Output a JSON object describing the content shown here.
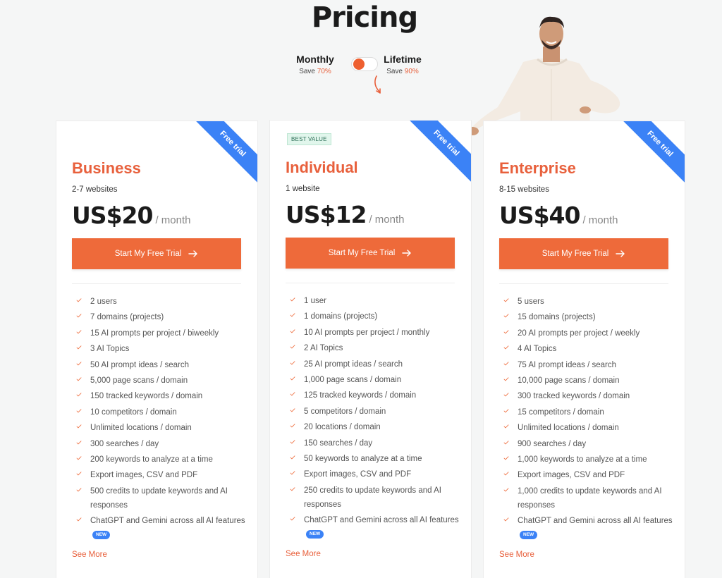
{
  "page": {
    "title": "Pricing"
  },
  "billing": {
    "monthly": {
      "label": "Monthly",
      "save_prefix": "Save ",
      "save_pct": "70%"
    },
    "lifetime": {
      "label": "Lifetime",
      "save_prefix": "Save ",
      "save_pct": "90%"
    },
    "selected": "monthly"
  },
  "colors": {
    "accent": "#ee6a3a",
    "ribbon": "#3b82f6",
    "badge_bg": "#e1f6ec"
  },
  "plans": [
    {
      "ribbon": "Free trial",
      "badge": "",
      "name": "Business",
      "sites": "2-7 websites",
      "price": "US$20",
      "period": "/ month",
      "cta": "Start My Free Trial",
      "features": [
        "2 users",
        "7 domains (projects)",
        "15 AI prompts per project / biweekly",
        "3 AI Topics",
        "50 AI prompt ideas / search",
        "5,000 page scans / domain",
        "150 tracked keywords / domain",
        "10 competitors / domain",
        "Unlimited locations / domain",
        "300 searches / day",
        "200 keywords to analyze at a time",
        "Export images, CSV and PDF",
        "500 credits to update keywords and AI responses",
        "ChatGPT and Gemini across all AI features"
      ],
      "new_badge": "NEW",
      "see_more": "See More"
    },
    {
      "ribbon": "Free trial",
      "badge": "BEST VALUE",
      "name": "Individual",
      "sites": "1 website",
      "price": "US$12",
      "period": "/ month",
      "cta": "Start My Free Trial",
      "features": [
        "1 user",
        "1 domains (projects)",
        "10 AI prompts per project / monthly",
        "2 AI Topics",
        "25 AI prompt ideas / search",
        "1,000 page scans / domain",
        "125 tracked keywords / domain",
        "5 competitors / domain",
        "20 locations / domain",
        "150 searches / day",
        "50 keywords to analyze at a time",
        "Export images, CSV and PDF",
        "250 credits to update keywords and AI responses",
        "ChatGPT and Gemini across all AI features"
      ],
      "new_badge": "NEW",
      "see_more": "See More"
    },
    {
      "ribbon": "Free trial",
      "badge": "",
      "name": "Enterprise",
      "sites": "8-15 websites",
      "price": "US$40",
      "period": "/ month",
      "cta": "Start My Free Trial",
      "features": [
        "5 users",
        "15 domains (projects)",
        "20 AI prompts per project / weekly",
        "4 AI Topics",
        "75 AI prompt ideas / search",
        "10,000 page scans / domain",
        "300 tracked keywords / domain",
        "15 competitors / domain",
        "Unlimited locations / domain",
        "900 searches / day",
        "1,000 keywords to analyze at a time",
        "Export images, CSV and PDF",
        "1,000 credits to update keywords and AI responses",
        "ChatGPT and Gemini across all AI features"
      ],
      "new_badge": "NEW",
      "see_more": "See More"
    }
  ]
}
